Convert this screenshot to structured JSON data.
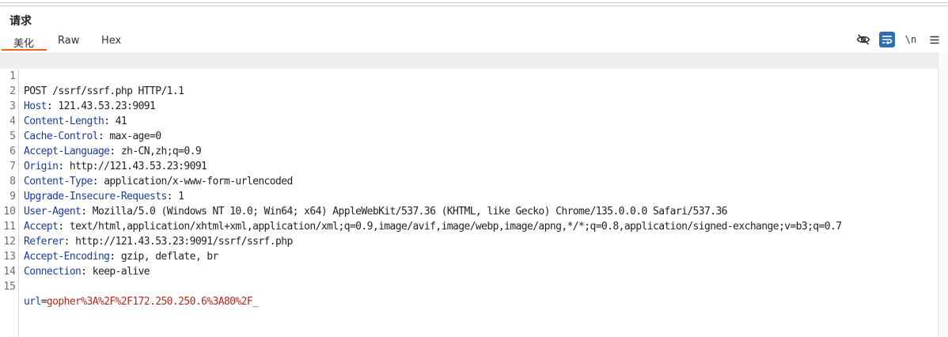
{
  "panel": {
    "title": "请求"
  },
  "tabs": [
    {
      "label": "美化",
      "active": true
    },
    {
      "label": "Raw",
      "active": false
    },
    {
      "label": "Hex",
      "active": false
    }
  ],
  "toolbar": {
    "hide_icon": "eye-slash-icon",
    "wrap_icon": "word-wrap-icon",
    "newline_label": "\\n",
    "menu_icon": "hamburger-menu-icon",
    "accent_color": "#2f6db5"
  },
  "colors": {
    "tab_underline": "#e8691e",
    "header_name": "#1b3d9e",
    "param_value": "#b5291d"
  },
  "request": {
    "request_line": "POST /ssrf/ssrf.php HTTP/1.1",
    "headers": [
      {
        "name": "Host",
        "value": "121.43.53.23:9091"
      },
      {
        "name": "Content-Length",
        "value": "41"
      },
      {
        "name": "Cache-Control",
        "value": "max-age=0"
      },
      {
        "name": "Accept-Language",
        "value": "zh-CN,zh;q=0.9"
      },
      {
        "name": "Origin",
        "value": "http://121.43.53.23:9091"
      },
      {
        "name": "Content-Type",
        "value": "application/x-www-form-urlencoded"
      },
      {
        "name": "Upgrade-Insecure-Requests",
        "value": "1"
      },
      {
        "name": "User-Agent",
        "value": "Mozilla/5.0 (Windows NT 10.0; Win64; x64) AppleWebKit/537.36 (KHTML, like Gecko) Chrome/135.0.0.0 Safari/537.36"
      },
      {
        "name": "Accept",
        "value": "text/html,application/xhtml+xml,application/xml;q=0.9,image/avif,image/webp,image/apng,*/*;q=0.8,application/signed-exchange;v=b3;q=0.7"
      },
      {
        "name": "Referer",
        "value": "http://121.43.53.23:9091/ssrf/ssrf.php"
      },
      {
        "name": "Accept-Encoding",
        "value": "gzip, deflate, br"
      },
      {
        "name": "Connection",
        "value": "keep-alive"
      }
    ],
    "body": {
      "name": "url",
      "value": "gopher%3A%2F%2F172.250.250.6%3A80%2F_"
    }
  },
  "line_numbers": [
    "1",
    "2",
    "3",
    "4",
    "5",
    "6",
    "7",
    "8",
    "9",
    "10",
    "11",
    "12",
    "13",
    "14",
    "15"
  ]
}
